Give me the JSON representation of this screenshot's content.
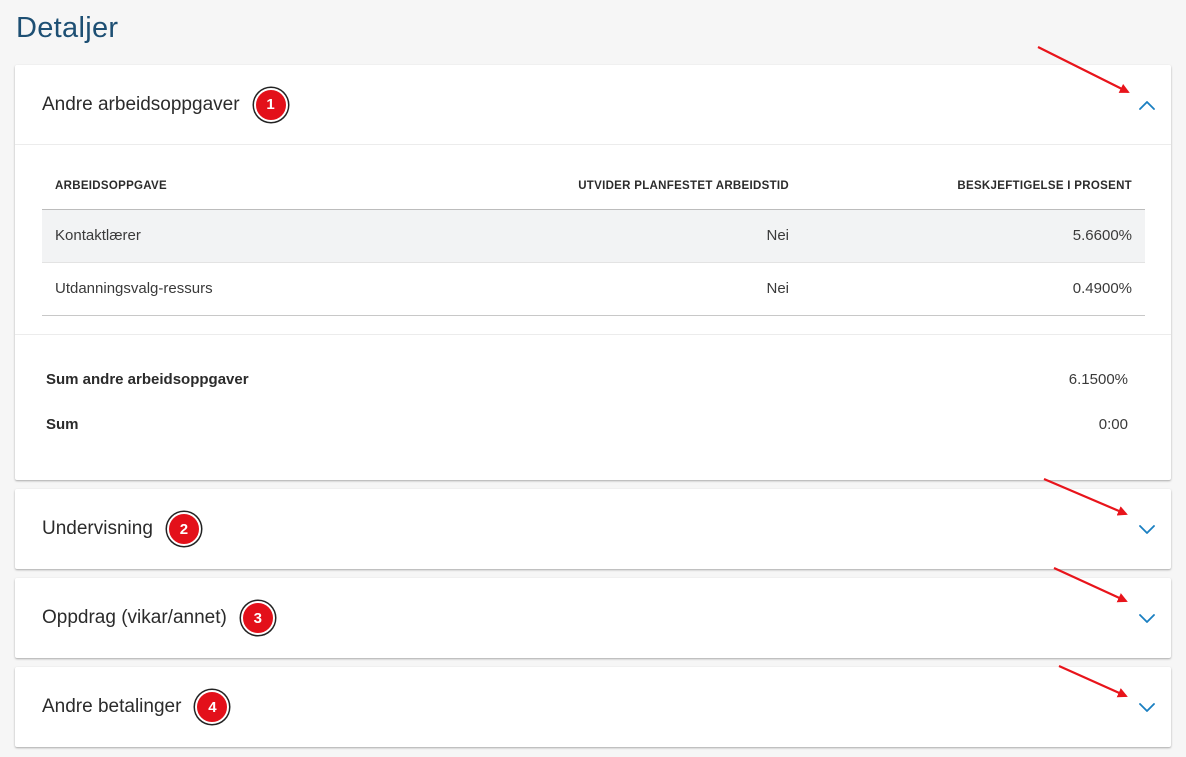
{
  "page": {
    "title": "Detaljer"
  },
  "sections": [
    {
      "title": "Andre arbeidsoppgaver",
      "badge": "1",
      "expanded": true,
      "chevron": "chevron-up-icon",
      "table": {
        "headers": [
          "ARBEIDSOPPGAVE",
          "UTVIDER PLANFESTET ARBEIDSTID",
          "BESKJEFTIGELSE I PROSENT"
        ],
        "rows": [
          [
            "Kontaktlærer",
            "Nei",
            "5.6600%"
          ],
          [
            "Utdanningsvalg-ressurs",
            "Nei",
            "0.4900%"
          ]
        ]
      },
      "sums": [
        {
          "label": "Sum andre arbeidsoppgaver",
          "value": "6.1500%"
        },
        {
          "label": "Sum",
          "value": "0:00"
        }
      ]
    },
    {
      "title": "Undervisning",
      "badge": "2",
      "expanded": false,
      "chevron": "chevron-down-icon"
    },
    {
      "title": "Oppdrag (vikar/annet)",
      "badge": "3",
      "expanded": false,
      "chevron": "chevron-down-icon"
    },
    {
      "title": "Andre betalinger",
      "badge": "4",
      "expanded": false,
      "chevron": "chevron-down-icon"
    }
  ],
  "colors": {
    "title": "#1d4f73",
    "chevron": "#1a7fc1",
    "badge": "#e3101a",
    "annotation_arrow": "#e8141b"
  }
}
